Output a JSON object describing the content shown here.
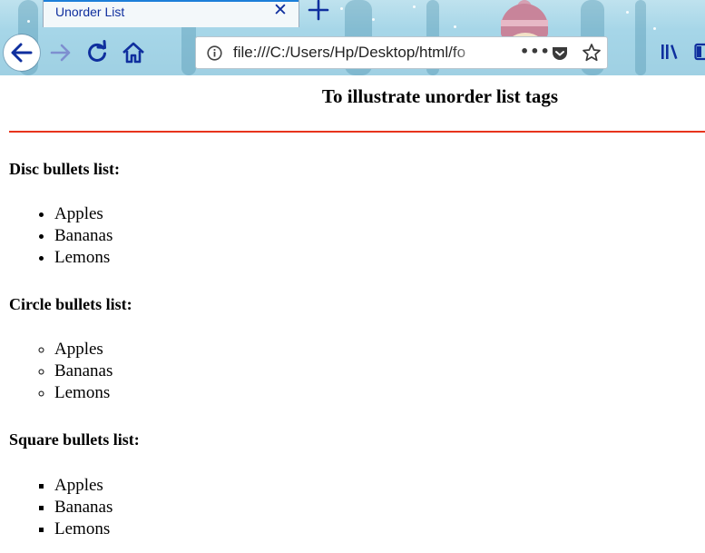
{
  "browser": {
    "tab_title": "Unorder List",
    "url": "file:///C:/Users/Hp/Desktop/html/fo",
    "more_glyph": "•••"
  },
  "page": {
    "title": "To illustrate unorder list tags",
    "accent_color": "#e8341c",
    "lists": [
      {
        "heading": "Disc bullets list:",
        "style": "disc",
        "items": [
          "Apples",
          "Bananas",
          "Lemons"
        ]
      },
      {
        "heading": "Circle bullets list:",
        "style": "circle",
        "items": [
          "Apples",
          "Bananas",
          "Lemons"
        ]
      },
      {
        "heading": "Square bullets list:",
        "style": "square",
        "items": [
          "Apples",
          "Bananas",
          "Lemons"
        ]
      }
    ]
  },
  "icons": [
    "close-icon",
    "plus-icon",
    "back-arrow-icon",
    "forward-arrow-icon",
    "reload-icon",
    "home-icon",
    "info-icon",
    "more-actions-icon",
    "pocket-icon",
    "bookmark-star-icon",
    "library-icon",
    "sidebar-icon"
  ]
}
